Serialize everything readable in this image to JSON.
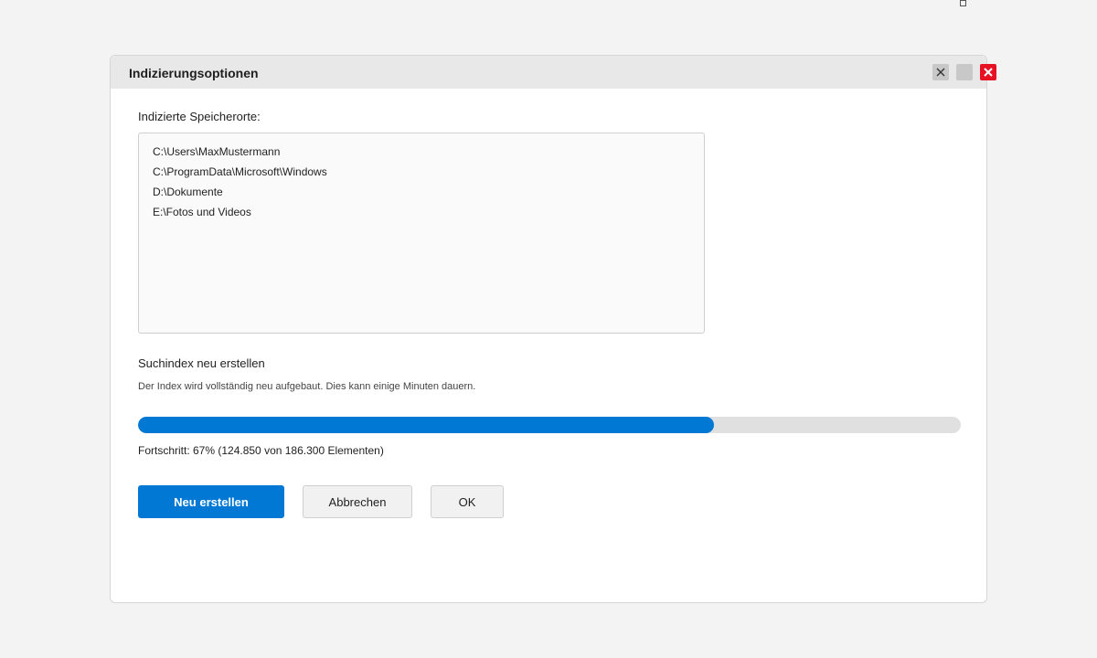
{
  "dialog": {
    "title": "Indizierungsoptionen"
  },
  "titlebar_buttons": {
    "help_icon": "close-x",
    "maximize_icon": "square",
    "close_icon": "close-x",
    "close_color": "#e81123"
  },
  "locations": {
    "label": "Indizierte Speicherorte:",
    "items": [
      "C:\\Users\\MaxMustermann",
      "C:\\ProgramData\\Microsoft\\Windows",
      "D:\\Dokumente",
      "E:\\Fotos und Videos"
    ]
  },
  "rebuild": {
    "title": "Suchindex neu erstellen",
    "description": "Der Index wird vollständig neu aufgebaut. Dies kann einige Minuten dauern.",
    "progress_percent": 70,
    "progress_text": "Fortschritt: 67% (124.850 von 186.300 Elementen)"
  },
  "buttons": {
    "rebuild_label": "Neu erstellen",
    "cancel_label": "Abbrechen",
    "ok_label": "OK"
  },
  "colors": {
    "accent": "#0078d4",
    "track": "#e0e0e0"
  }
}
